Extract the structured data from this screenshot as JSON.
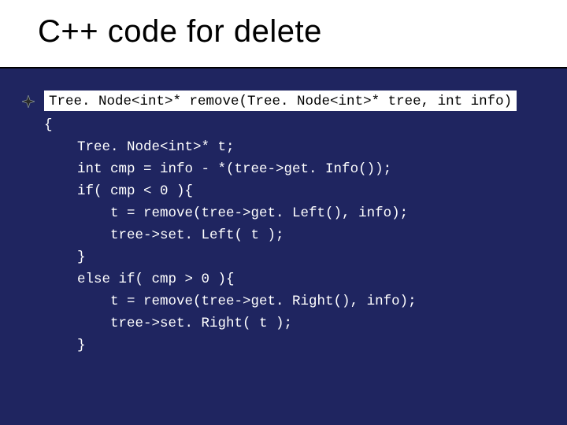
{
  "slide": {
    "title": "C++ code for delete",
    "bullet_icon": "diamond-star-icon",
    "code_highlight": "Tree. Node<int>* remove(Tree. Node<int>* tree, int info)",
    "code_lines": [
      "",
      "{",
      "    Tree. Node<int>* t;",
      "    int cmp = info - *(tree->get. Info());",
      "    if( cmp < 0 ){",
      "        t = remove(tree->get. Left(), info);",
      "        tree->set. Left( t );",
      "    }",
      "    else if( cmp > 0 ){",
      "        t = remove(tree->get. Right(), info);",
      "        tree->set. Right( t );",
      "    }"
    ]
  }
}
